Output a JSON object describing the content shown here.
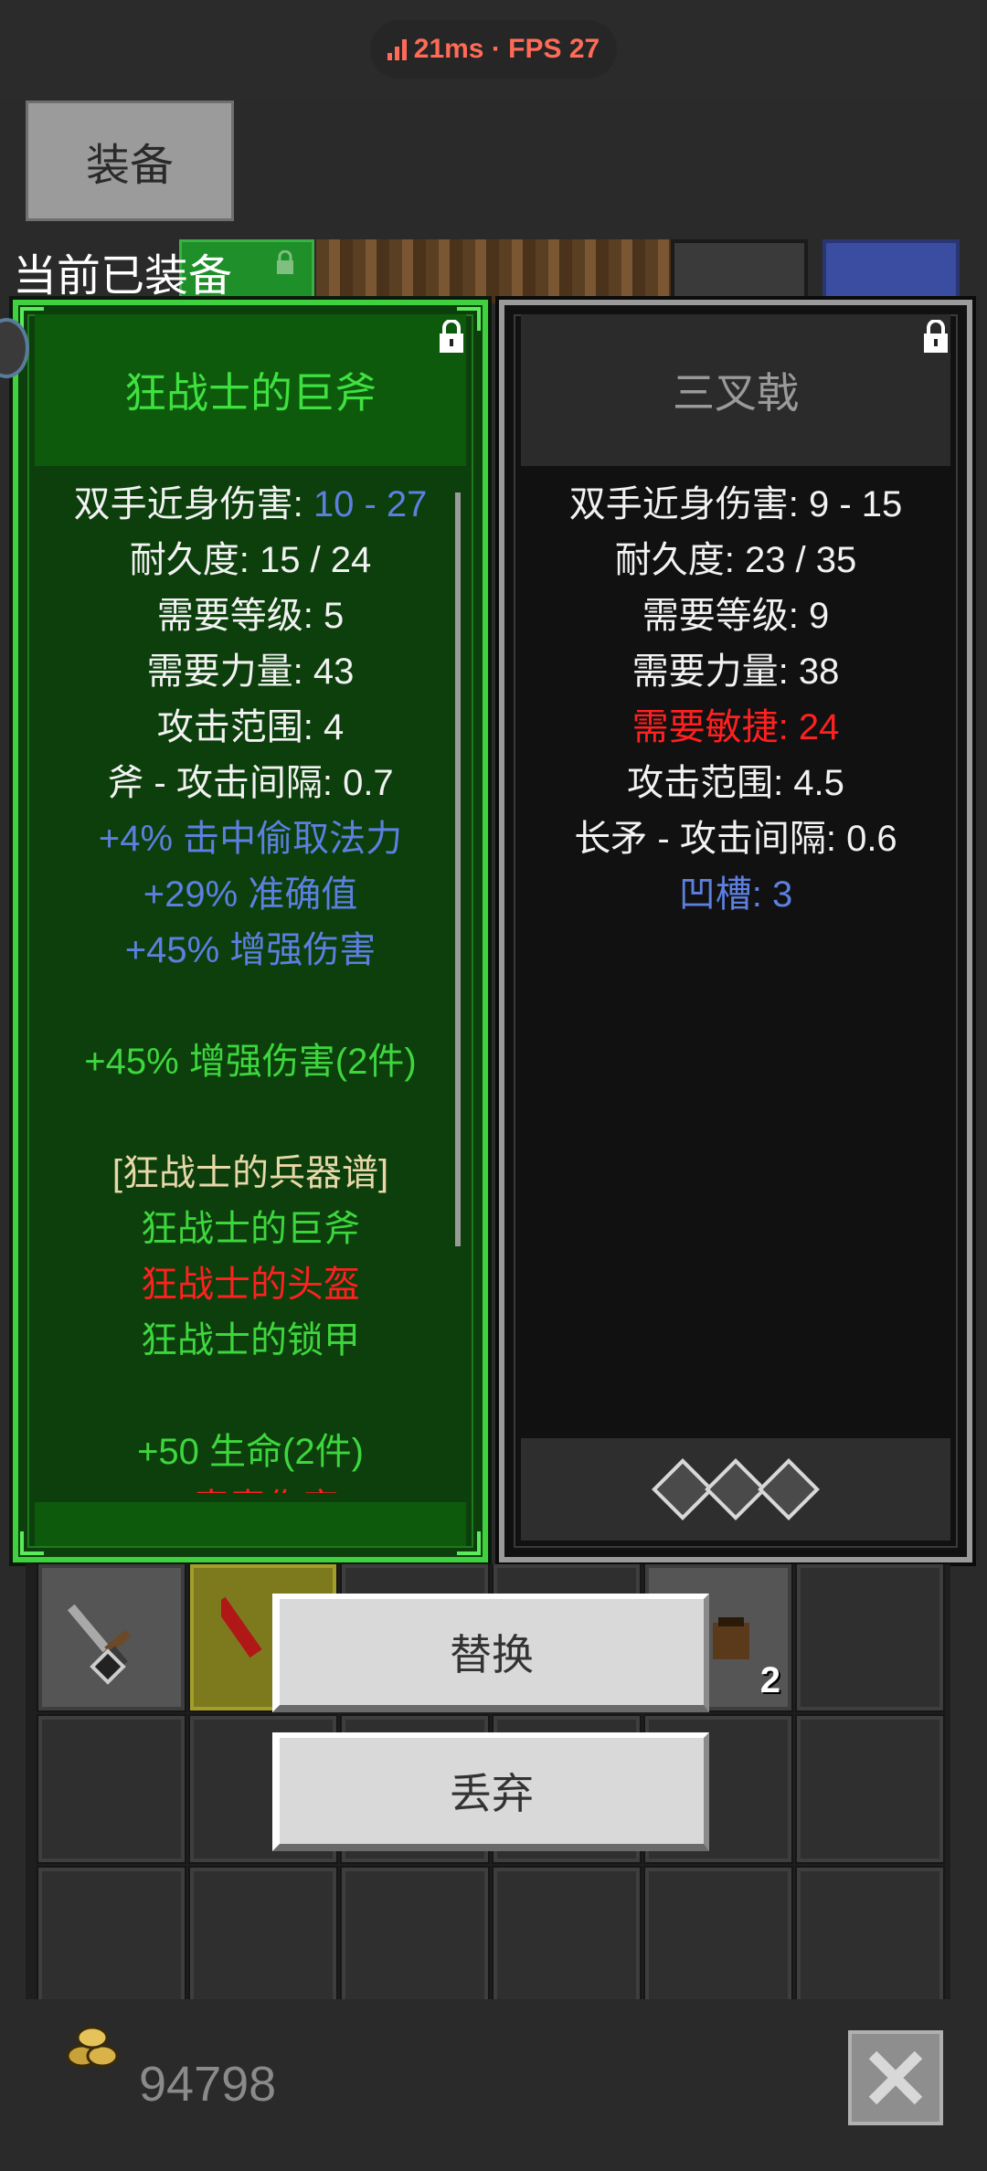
{
  "status": {
    "latency": "21ms",
    "sep": " · ",
    "fps_label": "FPS 27",
    "color": "#ff6b57"
  },
  "tab": {
    "label": "装备"
  },
  "equipped_label": "当前已装备",
  "left_item": {
    "name": "狂战士的巨斧",
    "lines": [
      {
        "parts": [
          {
            "t": "双手近身伤害: ",
            "c": "white"
          },
          {
            "t": "10 - 27",
            "c": "blue"
          }
        ]
      },
      {
        "parts": [
          {
            "t": "耐久度: 15 / 24",
            "c": "white"
          }
        ]
      },
      {
        "parts": [
          {
            "t": "需要等级: 5",
            "c": "white"
          }
        ]
      },
      {
        "parts": [
          {
            "t": "需要力量: 43",
            "c": "white"
          }
        ]
      },
      {
        "parts": [
          {
            "t": "攻击范围: 4",
            "c": "white"
          }
        ]
      },
      {
        "parts": [
          {
            "t": "斧 - 攻击间隔: 0.7",
            "c": "white"
          }
        ]
      },
      {
        "parts": [
          {
            "t": "+4% 击中偷取法力",
            "c": "blue"
          }
        ]
      },
      {
        "parts": [
          {
            "t": "+29% 准确值",
            "c": "blue"
          }
        ]
      },
      {
        "parts": [
          {
            "t": "+45% 增强伤害",
            "c": "blue"
          }
        ]
      },
      {
        "parts": [
          {
            "t": "",
            "c": "white"
          }
        ]
      },
      {
        "parts": [
          {
            "t": "+45% 增强伤害(2件)",
            "c": "green"
          }
        ]
      },
      {
        "parts": [
          {
            "t": "",
            "c": "white"
          }
        ]
      },
      {
        "parts": [
          {
            "t": "[狂战士的兵器谱]",
            "c": "gold"
          }
        ]
      },
      {
        "parts": [
          {
            "t": "狂战士的巨斧",
            "c": "green"
          }
        ]
      },
      {
        "parts": [
          {
            "t": "狂战士的头盔",
            "c": "red"
          }
        ]
      },
      {
        "parts": [
          {
            "t": "狂战士的锁甲",
            "c": "green"
          }
        ]
      },
      {
        "parts": [
          {
            "t": "",
            "c": "white"
          }
        ]
      },
      {
        "parts": [
          {
            "t": "+50 生命(2件)",
            "c": "green"
          }
        ]
      },
      {
        "parts": [
          {
            "t": "+ 毒素伤害",
            "c": "red"
          }
        ]
      }
    ]
  },
  "right_item": {
    "name": "三叉戟",
    "lines": [
      {
        "parts": [
          {
            "t": "双手近身伤害: 9 - 15",
            "c": "white"
          }
        ]
      },
      {
        "parts": [
          {
            "t": "耐久度: 23 / 35",
            "c": "white"
          }
        ]
      },
      {
        "parts": [
          {
            "t": "需要等级: 9",
            "c": "white"
          }
        ]
      },
      {
        "parts": [
          {
            "t": "需要力量: 38",
            "c": "white"
          }
        ]
      },
      {
        "parts": [
          {
            "t": "需要敏捷: 24",
            "c": "red"
          }
        ]
      },
      {
        "parts": [
          {
            "t": "攻击范围: 4.5",
            "c": "white"
          }
        ]
      },
      {
        "parts": [
          {
            "t": "长矛 - 攻击间隔: 0.6",
            "c": "white"
          }
        ]
      },
      {
        "parts": [
          {
            "t": "凹槽: 3",
            "c": "blue"
          }
        ]
      }
    ],
    "sockets": 3
  },
  "actions": {
    "replace": "替换",
    "discard": "丢弃"
  },
  "inventory": {
    "stack_count": "2"
  },
  "gold": {
    "amount": "94798"
  },
  "colors": {
    "set_green": "#3fd13f",
    "magic_blue": "#5d7fe0",
    "warn_red": "#ff2020"
  }
}
